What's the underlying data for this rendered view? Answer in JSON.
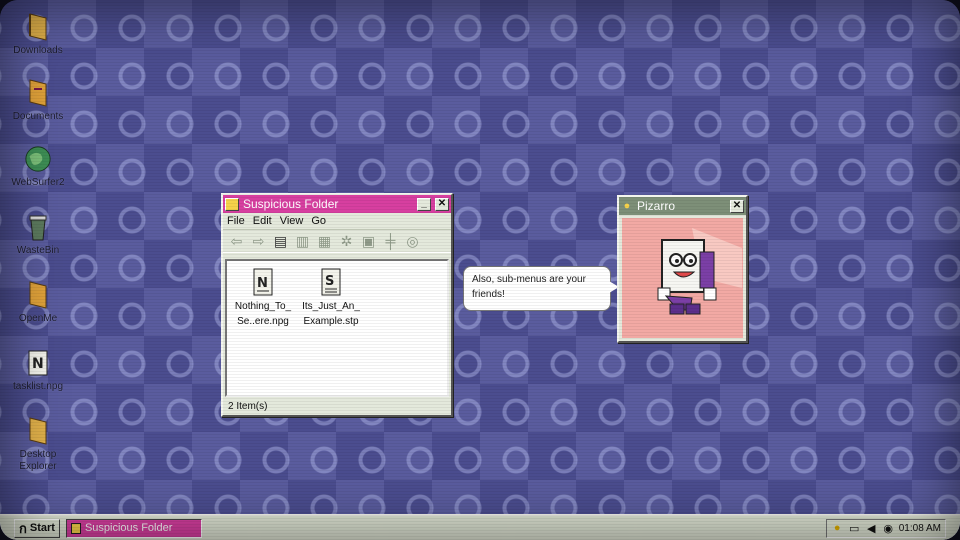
{
  "desktop": {
    "icons": [
      {
        "label": "Downloads",
        "icon": "folder-icon"
      },
      {
        "label": "Documents",
        "icon": "folder-icon"
      },
      {
        "label": "WebSurfer2",
        "icon": "globe-icon"
      },
      {
        "label": "WasteBin",
        "icon": "trash-icon"
      },
      {
        "label": "OpenMe",
        "icon": "folder-icon"
      },
      {
        "label": "tasklist.npg",
        "icon": "notepad-file-icon"
      },
      {
        "label": "Desktop Explorer",
        "icon": "folder-icon"
      }
    ]
  },
  "explorer": {
    "title": "Suspicious Folder",
    "menu": [
      "File",
      "Edit",
      "View",
      "Go"
    ],
    "toolbar": [
      "back-arrow-icon",
      "forward-arrow-icon",
      "up-folder-icon",
      "cut-icon",
      "copy-icon",
      "settings-gear-icon",
      "disk-icon",
      "align-icon",
      "refresh-icon"
    ],
    "files": [
      {
        "line1": "Nothing_To_",
        "line2": "Se..ere.npg",
        "icon": "notepad-file-icon"
      },
      {
        "line1": "Its_Just_An_",
        "line2": "Example.stp",
        "icon": "script-file-icon"
      }
    ],
    "status": "2 Item(s)"
  },
  "assistant": {
    "title": "Pizarro",
    "message": "Also, sub-menus are your friends!"
  },
  "taskbar": {
    "start_label": "Start",
    "task_label": "Suspicious Folder",
    "clock": "01:08 AM"
  },
  "colors": {
    "accent": "#d73fa0",
    "desktop": "#4b4d8f",
    "window": "#e4e9dc"
  }
}
